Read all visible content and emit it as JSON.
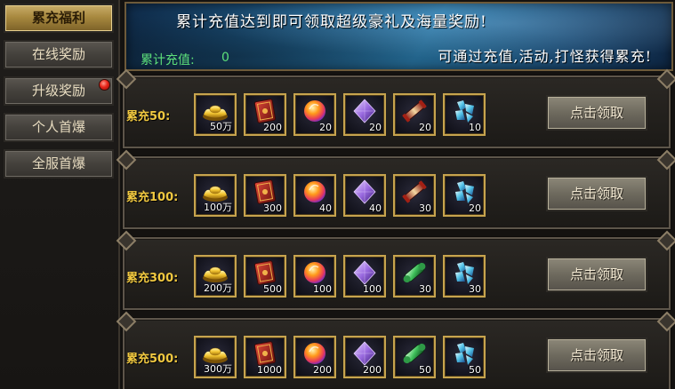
{
  "sidebar": {
    "tabs": [
      {
        "label": "累充福利",
        "active": true
      },
      {
        "label": "在线奖励",
        "active": false
      },
      {
        "label": "升级奖励",
        "active": false,
        "badge": true
      },
      {
        "label": "个人首爆",
        "active": false
      },
      {
        "label": "全服首爆",
        "active": false
      }
    ]
  },
  "banner": {
    "headline": "累计充值达到即可领取超级豪礼及海量奖励!",
    "total_label": "累计充值:",
    "total_value": "0",
    "hint": "可通过充值,活动,打怪获得累充!"
  },
  "rows": [
    {
      "label": "累充50:",
      "items": [
        {
          "icon": "gold-ingot-icon",
          "qty": "50万"
        },
        {
          "icon": "red-book-icon",
          "qty": "200"
        },
        {
          "icon": "fire-orb-icon",
          "qty": "20"
        },
        {
          "icon": "purple-crystal-icon",
          "qty": "20"
        },
        {
          "icon": "red-scroll-icon",
          "qty": "20"
        },
        {
          "icon": "blue-ice-crystal-icon",
          "qty": "10"
        }
      ],
      "button": "点击领取"
    },
    {
      "label": "累充100:",
      "items": [
        {
          "icon": "gold-ingot-icon",
          "qty": "100万"
        },
        {
          "icon": "red-book-icon",
          "qty": "300"
        },
        {
          "icon": "fire-orb-icon",
          "qty": "40"
        },
        {
          "icon": "purple-crystal-icon",
          "qty": "40"
        },
        {
          "icon": "red-scroll-icon",
          "qty": "30"
        },
        {
          "icon": "blue-ice-crystal-icon",
          "qty": "20"
        }
      ],
      "button": "点击领取"
    },
    {
      "label": "累充300:",
      "items": [
        {
          "icon": "gold-ingot-icon",
          "qty": "200万"
        },
        {
          "icon": "red-book-icon",
          "qty": "500"
        },
        {
          "icon": "fire-orb-icon",
          "qty": "100"
        },
        {
          "icon": "purple-crystal-icon",
          "qty": "100"
        },
        {
          "icon": "green-scroll-icon",
          "qty": "30"
        },
        {
          "icon": "blue-ice-crystal-icon",
          "qty": "30"
        }
      ],
      "button": "点击领取"
    },
    {
      "label": "累充500:",
      "items": [
        {
          "icon": "gold-ingot-icon",
          "qty": "300万"
        },
        {
          "icon": "red-book-icon",
          "qty": "1000"
        },
        {
          "icon": "fire-orb-icon",
          "qty": "200"
        },
        {
          "icon": "purple-crystal-icon",
          "qty": "200"
        },
        {
          "icon": "green-scroll-icon",
          "qty": "50"
        },
        {
          "icon": "blue-ice-crystal-icon",
          "qty": "50"
        }
      ],
      "button": "点击领取"
    }
  ],
  "colors": {
    "accent_gold": "#c7a44e",
    "tier_label": "#f0c840",
    "total_green": "#5de07a",
    "badge_red": "#e8251a"
  }
}
